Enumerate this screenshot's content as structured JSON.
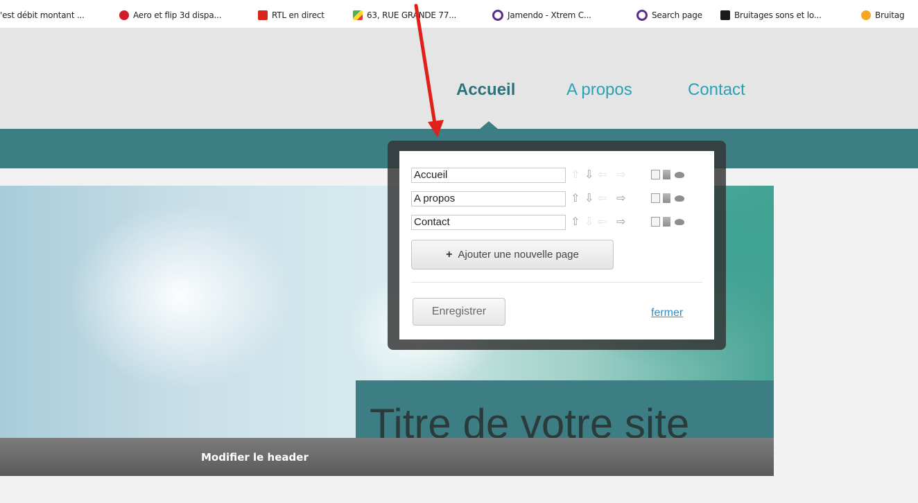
{
  "bookmarks": [
    {
      "label": "'est débit montant ...",
      "icon": "none"
    },
    {
      "label": "Aero et flip 3d dispa...",
      "icon": "red-badge-icon"
    },
    {
      "label": "RTL en direct",
      "icon": "rtl-logo-icon"
    },
    {
      "label": "63, RUE GRANDE 77...",
      "icon": "maps-icon"
    },
    {
      "label": "Jamendo - Xtrem C...",
      "icon": "record-circle-icon"
    },
    {
      "label": "Search page",
      "icon": "record-circle-icon"
    },
    {
      "label": "Bruitages sons et lo...",
      "icon": "music-page-icon"
    },
    {
      "label": "Bruitag",
      "icon": "orange-bubble-icon"
    }
  ],
  "nav": {
    "items": [
      "Accueil",
      "A propos",
      "Contact"
    ],
    "active": "Accueil"
  },
  "site": {
    "title": "Titre de votre site",
    "header_bar_label": "Modifier le header"
  },
  "popup": {
    "pages": [
      {
        "name": "Accueil",
        "can_move_up": false,
        "can_move_down": true,
        "can_indent": false
      },
      {
        "name": "A propos",
        "can_move_up": true,
        "can_move_down": true,
        "can_indent": true
      },
      {
        "name": "Contact",
        "can_move_up": true,
        "can_move_down": false,
        "can_indent": true
      }
    ],
    "add_button_label": "Ajouter une nouvelle page",
    "save_button_label": "Enregistrer",
    "close_link_label": "fermer"
  },
  "colors": {
    "teal_band": "#3c7e83",
    "nav_active": "#2e7277",
    "nav_link": "#2ca1b4",
    "annotation_arrow": "#e0201a",
    "close_link": "#2a8fd1"
  }
}
